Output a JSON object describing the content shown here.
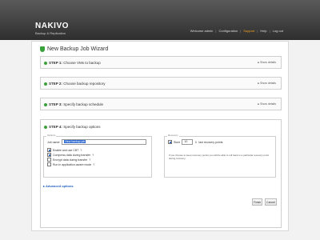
{
  "brand": {
    "name": "NAKIVO",
    "tagline": "Backup & Replication"
  },
  "nav": {
    "welcome": "Welcome admin",
    "configuration": "Configuration",
    "support": "Support",
    "help": "Help",
    "logout": "Log out"
  },
  "wizard": {
    "title": "New Backup Job Wizard",
    "steps": [
      {
        "prefix": "STEP 1:",
        "label": "Choose VMs to backup",
        "toggle": "Show details"
      },
      {
        "prefix": "STEP 2:",
        "label": "Choose backup repository",
        "toggle": "Show details"
      },
      {
        "prefix": "STEP 3:",
        "label": "Specify backup schedule",
        "toggle": "Show details"
      }
    ],
    "step4": {
      "prefix": "STEP 4:",
      "label": "Specify backup options",
      "options_caption": "Options",
      "job_name_label": "Job name:",
      "job_name_value": "New backup job",
      "checkboxes": [
        {
          "label": "Enable and use CBT",
          "checked": true,
          "help": "?"
        },
        {
          "label": "Compress data during transfer",
          "checked": true,
          "help": "?"
        },
        {
          "label": "Encrypt data during transfer",
          "checked": false,
          "help": "?"
        },
        {
          "label": "Run in application-aware mode",
          "checked": false,
          "help": "?"
        }
      ],
      "recovery_caption": "Recovery",
      "store_label": "Store",
      "store_value": "10",
      "store_suffix": "last recovery points",
      "note": "If you choose to keep recovery points you will be able to roll back to a particular recovery point during recovery."
    },
    "advanced": "Advanced options",
    "buttons": {
      "finish": "Finish",
      "cancel": "Cancel"
    }
  }
}
